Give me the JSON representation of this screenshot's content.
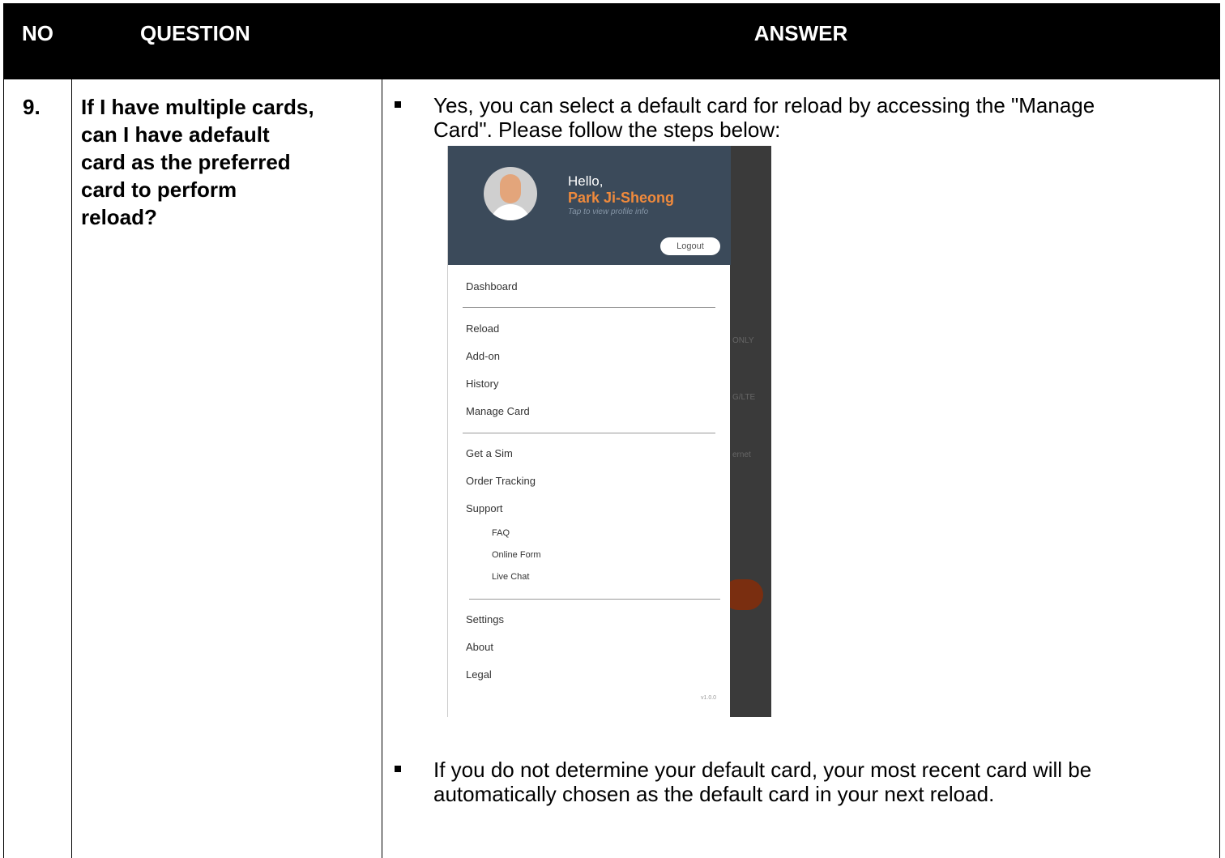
{
  "header": {
    "no": "NO",
    "question": "QUESTION",
    "answer": "ANSWER"
  },
  "row": {
    "no": "9.",
    "question_lines": [
      "If I have multiple cards,",
      "can I have adefault",
      "card as the preferred",
      "card to perform",
      "reload?"
    ],
    "answer1_lines": [
      "Yes, you can select a default card for reload by accessing the \"Manage",
      "Card\". Please follow the steps below:"
    ],
    "answer2_lines": [
      "If you do not determine your default card, your most recent card will be",
      "automatically chosen as the default card in your next reload."
    ]
  },
  "phone": {
    "greeting": "Hello,",
    "user_name": "Park Ji-Sheong",
    "profile_hint": "Tap to view profile info",
    "logout_label": "Logout",
    "menu": [
      "Dashboard",
      "Reload",
      "Add-on",
      "History",
      "Manage Card",
      "Get a Sim",
      "Order Tracking",
      "Support"
    ],
    "support_sub": [
      "FAQ",
      "Online Form",
      "Live Chat"
    ],
    "menu_bottom": [
      "Settings",
      "About",
      "Legal"
    ],
    "version": "v1.0.0",
    "bg_fragments": [
      "ONLY",
      "G/LTE",
      "ernet"
    ],
    "colors": {
      "drawer_header": "#3b4a5a",
      "accent": "#f08a3c"
    }
  }
}
